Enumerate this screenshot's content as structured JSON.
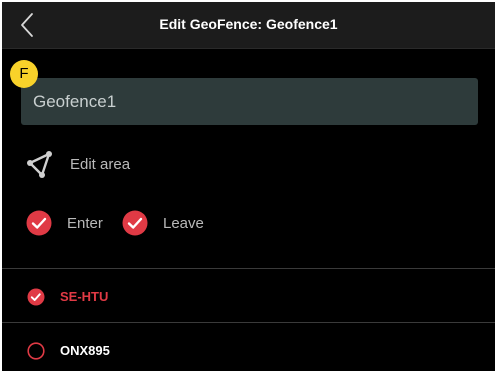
{
  "header": {
    "title": "Edit GeoFence: Geofence1",
    "back_icon": "chevron-left-icon"
  },
  "badge": {
    "label": "F",
    "color": "#f8d22a"
  },
  "name_field": {
    "value": "Geofence1",
    "background": "#2e3b3b"
  },
  "edit_area": {
    "label": "Edit area",
    "icon": "polygon-icon"
  },
  "triggers": [
    {
      "label": "Enter",
      "checked": true
    },
    {
      "label": "Leave",
      "checked": true
    }
  ],
  "aircraft": [
    {
      "label": "SE-HTU",
      "selected": true
    },
    {
      "label": "ONX895",
      "selected": false
    }
  ],
  "colors": {
    "accent": "#e03a45",
    "background": "#000000",
    "header": "#1c1c1c"
  }
}
